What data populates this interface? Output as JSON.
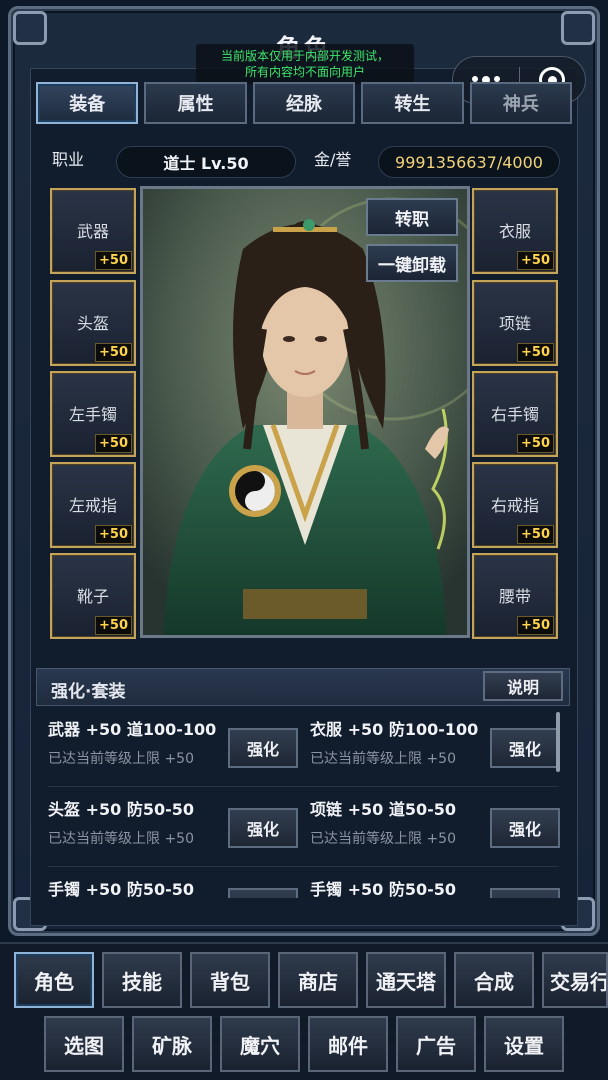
{
  "window": {
    "title": "角色"
  },
  "notice": {
    "line1": "当前版本仅用于内部开发测试，",
    "line2": "所有内容均不面向用户"
  },
  "tabs": [
    {
      "label": "装备",
      "active": true
    },
    {
      "label": "属性"
    },
    {
      "label": "经脉"
    },
    {
      "label": "转生"
    },
    {
      "label": "神兵"
    }
  ],
  "info": {
    "job_label": "职业",
    "job_value": "道士 Lv.50",
    "gold_label": "金/誉",
    "gold_value": "9991356637/4000"
  },
  "slots_left": [
    {
      "name": "武器",
      "level": "+50"
    },
    {
      "name": "头盔",
      "level": "+50"
    },
    {
      "name": "左手镯",
      "level": "+50"
    },
    {
      "name": "左戒指",
      "level": "+50"
    },
    {
      "name": "靴子",
      "level": "+50"
    }
  ],
  "slots_right": [
    {
      "name": "衣服",
      "level": "+50"
    },
    {
      "name": "项链",
      "level": "+50"
    },
    {
      "name": "右手镯",
      "level": "+50"
    },
    {
      "name": "右戒指",
      "level": "+50"
    },
    {
      "name": "腰带",
      "level": "+50"
    }
  ],
  "portrait_buttons": {
    "transfer": "转职",
    "unequip_all": "一键卸载"
  },
  "section": {
    "title": "强化·套装",
    "help": "说明"
  },
  "enhance": [
    {
      "main": "武器 +50 道100-100",
      "sub": "已达当前等级上限 +50",
      "btn": "强化"
    },
    {
      "main": "衣服 +50 防100-100",
      "sub": "已达当前等级上限 +50",
      "btn": "强化"
    },
    {
      "main": "头盔 +50 防50-50",
      "sub": "已达当前等级上限 +50",
      "btn": "强化"
    },
    {
      "main": "项链 +50 道50-50",
      "sub": "已达当前等级上限 +50",
      "btn": "强化"
    },
    {
      "main": "手镯 +50 防50-50",
      "sub": "",
      "btn": ""
    },
    {
      "main": "手镯 +50 防50-50",
      "sub": "",
      "btn": ""
    }
  ],
  "nav_row1": [
    {
      "label": "角色",
      "active": true
    },
    {
      "label": "技能"
    },
    {
      "label": "背包"
    },
    {
      "label": "商店"
    },
    {
      "label": "通天塔"
    },
    {
      "label": "合成"
    },
    {
      "label": "交易行"
    }
  ],
  "nav_row2": [
    {
      "label": "选图"
    },
    {
      "label": "矿脉"
    },
    {
      "label": "魔穴"
    },
    {
      "label": "邮件"
    },
    {
      "label": "广告"
    },
    {
      "label": "设置"
    }
  ],
  "colors": {
    "accent_gold": "#c4a45a",
    "level_yellow": "#ffd34a",
    "notice_green": "#3ee66c"
  }
}
